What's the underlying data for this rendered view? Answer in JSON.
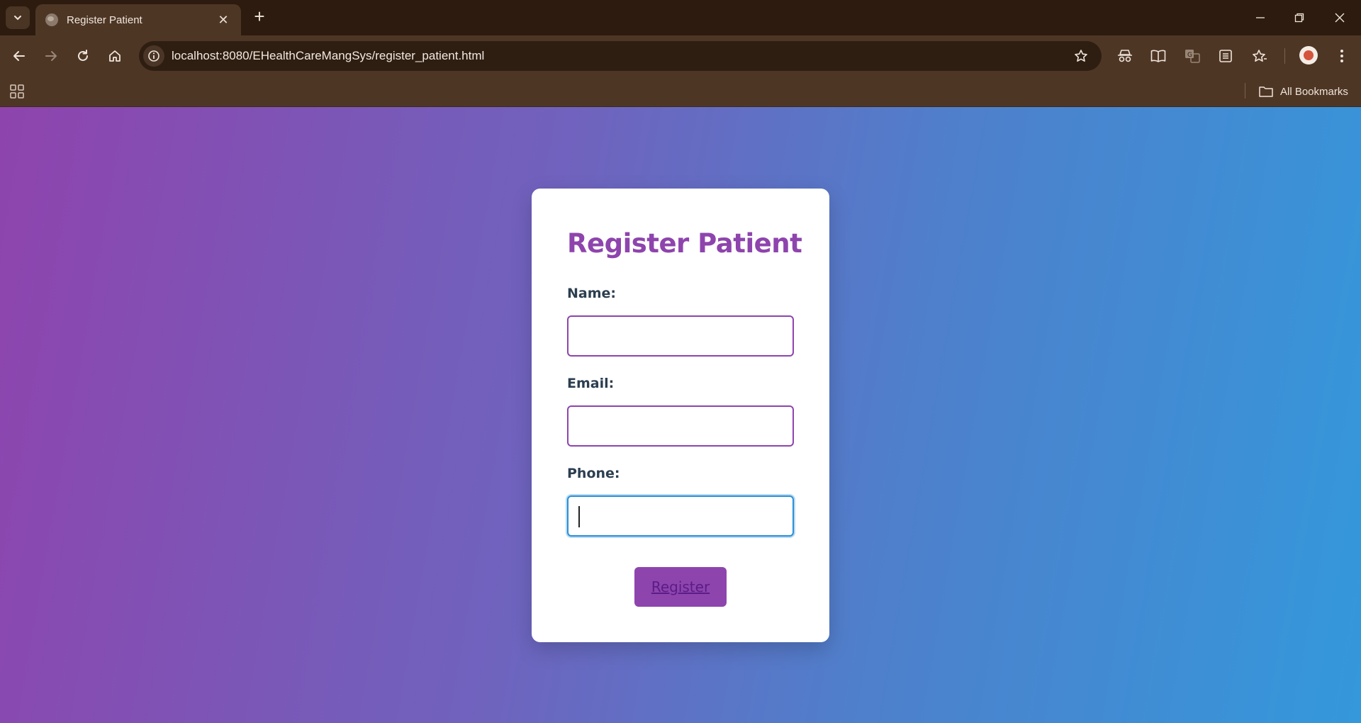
{
  "browser": {
    "tab": {
      "title": "Register Patient",
      "close_glyph": "✕"
    },
    "new_tab_glyph": "+",
    "url": "localhost:8080/EHealthCareMangSys/register_patient.html",
    "bookmarks": {
      "all_label": "All Bookmarks"
    },
    "icons": {
      "tab_menu": "chevron-down-icon",
      "back": "arrow-left-icon",
      "forward": "arrow-right-icon",
      "reload": "reload-icon",
      "home": "home-icon",
      "site_info": "info-icon",
      "bookmark": "star-icon",
      "extensions": [
        "incognito-icon",
        "reading-mode-icon",
        "translate-icon",
        "reading-list-icon",
        "bookmarks-star-icon"
      ],
      "profile": "avatar-icon",
      "apps": "apps-grid-icon",
      "folder": "folder-icon"
    },
    "colors": {
      "frame": "#2c1b0e",
      "toolbar": "#4e3625",
      "omnibox": "#2e1e12"
    }
  },
  "page": {
    "title": "Register Patient",
    "fields": [
      {
        "label": "Name:",
        "value": ""
      },
      {
        "label": "Email:",
        "value": ""
      },
      {
        "label": "Phone:",
        "value": ""
      }
    ],
    "submit_label": "Register",
    "colors": {
      "accent": "#8e44ad",
      "gradient_start": "#8e44ad",
      "gradient_end": "#3498db",
      "label": "#2c3e50",
      "focus": "#3498db"
    }
  }
}
